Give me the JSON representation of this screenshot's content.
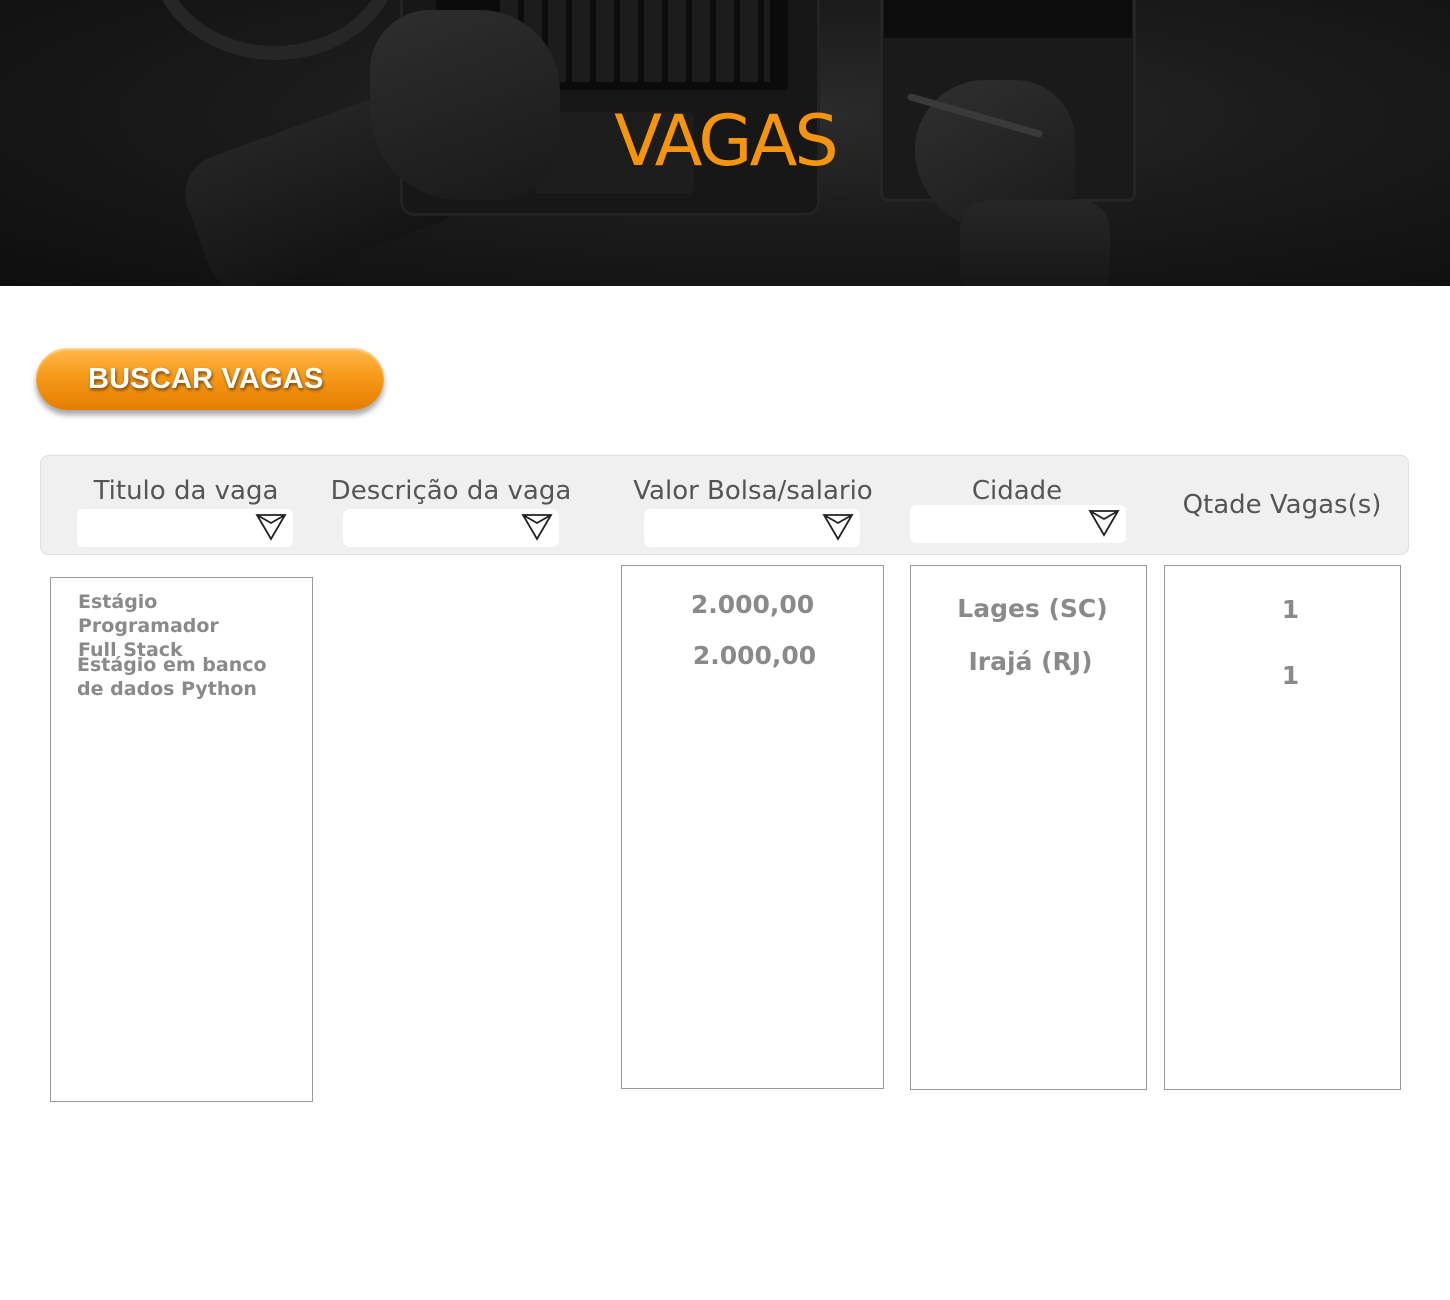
{
  "hero": {
    "title": "VAGAS"
  },
  "search_button": {
    "label": "BUSCAR VAGAS"
  },
  "filters": {
    "columns": [
      {
        "label": "Titulo da vaga"
      },
      {
        "label": "Descrição da vaga"
      },
      {
        "label": "Valor Bolsa/salario"
      },
      {
        "label": "Cidade"
      },
      {
        "label": "Qtade Vagas(s)"
      }
    ]
  },
  "results": {
    "titles": [
      {
        "line1": "Estágio Programador",
        "line2": "Full Stack"
      },
      {
        "line1": "Estágio em banco",
        "line2": "de dados Python"
      }
    ],
    "values": [
      "2.000,00",
      "2.000,00"
    ],
    "cities": [
      "Lages (SC)",
      "Irajá (RJ)"
    ],
    "quantities": [
      "1",
      "1"
    ]
  },
  "colors": {
    "accent_orange": "#f5940f",
    "panel_gray": "#f0f0f0",
    "text_gray": "#8a8a8a",
    "header_text": "#555555"
  },
  "icons": {
    "dropdown": "triangle-down-icon"
  }
}
